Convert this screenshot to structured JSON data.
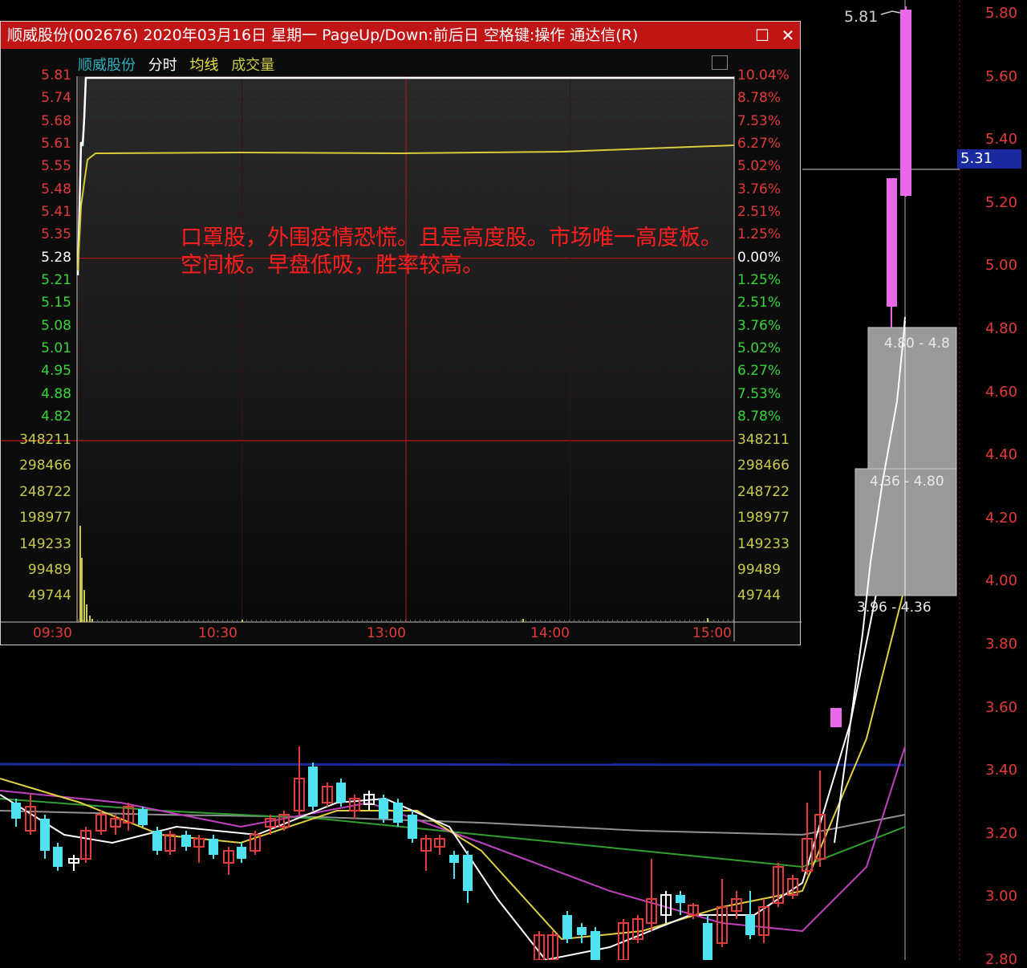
{
  "window": {
    "title": "顺威股份(002676) 2020年03月16日 星期一 PageUp/Down:前后日 空格键:操作 通达信(R)",
    "restore_icon": "restore-icon",
    "close_icon": "close-icon"
  },
  "legend": {
    "name": "顺威股份",
    "fenshi": "分时",
    "junxian": "均线",
    "volume": "成交量"
  },
  "intraday": {
    "price_labels": [
      "5.81",
      "5.74",
      "5.68",
      "5.61",
      "5.55",
      "5.48",
      "5.41",
      "5.35",
      "5.28",
      "5.21",
      "5.15",
      "5.08",
      "5.01",
      "4.95",
      "4.88",
      "4.82"
    ],
    "pct_labels": [
      "10.04%",
      "8.78%",
      "7.53%",
      "6.27%",
      "5.02%",
      "3.76%",
      "2.51%",
      "1.25%",
      "0.00%",
      "1.25%",
      "2.51%",
      "3.76%",
      "5.02%",
      "6.27%",
      "7.53%",
      "8.78%"
    ],
    "volume_labels": [
      "348211",
      "298466",
      "248722",
      "198977",
      "149233",
      "99489",
      "49744"
    ],
    "time_labels": [
      "09:30",
      "10:30",
      "13:00",
      "14:00",
      "15:00"
    ],
    "prev_close": 5.28,
    "colors": {
      "up": "#e23b3b",
      "down": "#36d63a",
      "flat": "#ffffff",
      "vol": "#c9c94a",
      "avg": "#d8cc3a"
    }
  },
  "note": {
    "line1": "口罩股，外围疫情恐慌。且是高度股。市场唯一高度板。",
    "line2": "空间板。早盘低吸，胜率较高。"
  },
  "kline": {
    "top_price": "5.81",
    "current_price": "5.31",
    "right_axis": [
      "5.80",
      "5.60",
      "5.40",
      "5.20",
      "5.00",
      "4.80",
      "4.60",
      "4.40",
      "4.20",
      "4.00",
      "3.80",
      "3.60",
      "3.40",
      "3.20",
      "3.00",
      "2.80"
    ],
    "chips": [
      {
        "label": "4.80 - 4.8"
      },
      {
        "label": "4.36 - 4.80"
      },
      {
        "label": "3.96 - 4.36"
      }
    ],
    "colors": {
      "up": "#e23b3b",
      "down": "#4fe2f0",
      "limit": "#e86ae8",
      "ma5": "#ffffff",
      "ma10": "#e0d040",
      "ma20": "#c040c0",
      "ma60": "#30a030",
      "ma120": "#909090",
      "ma250": "#1a2aa0"
    }
  }
}
